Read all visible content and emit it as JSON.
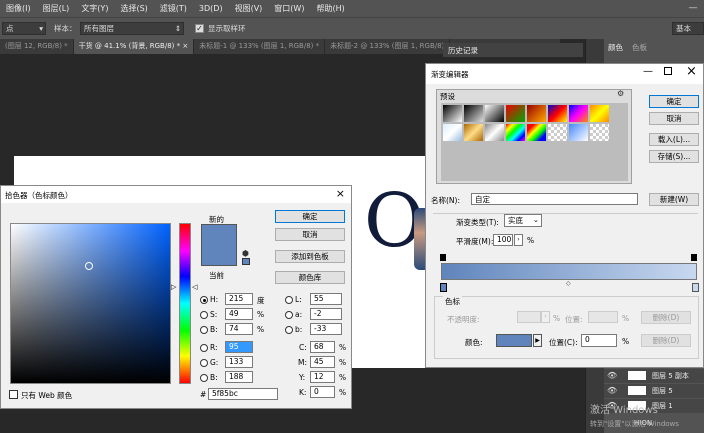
{
  "menubar": {
    "items": [
      "图像(I)",
      "图层(L)",
      "文字(Y)",
      "选择(S)",
      "滤镜(T)",
      "3D(D)",
      "视图(V)",
      "窗口(W)",
      "帮助(H)"
    ]
  },
  "options": {
    "point_label": "点",
    "sample_label": "样本：",
    "sample_value": "所有图层",
    "show_ring_label": "显示取样环",
    "basic_label": "基本"
  },
  "tabs": [
    "(图层 12, RGB/8) *",
    "干货 @ 41.1% (背景, RGB/8) *",
    "未标题-1 @ 133% (图层 1, RGB/8) *",
    "未标题-2 @ 133% (图层 1, RGB/8)"
  ],
  "right_panel": {
    "history_tab": "历史记录",
    "color_tab": "颜色",
    "swatch_tab": "色板",
    "layers": [
      {
        "name": "图层 5 副本"
      },
      {
        "name": "图层 5"
      },
      {
        "name": "图层 1"
      }
    ],
    "bottom_label": "HION"
  },
  "canvas": {
    "text": "O"
  },
  "color_picker": {
    "title": "拾色器（色标颜色）",
    "new_label": "新的",
    "current_label": "当前",
    "ok": "确定",
    "cancel": "取消",
    "add_swatch": "添加到色板",
    "color_libraries": "颜色库",
    "fields": {
      "H": {
        "label": "H:",
        "value": "215",
        "unit": "度"
      },
      "S": {
        "label": "S:",
        "value": "49",
        "unit": "%"
      },
      "B": {
        "label": "B:",
        "value": "74",
        "unit": "%"
      },
      "R": {
        "label": "R:",
        "value": "95"
      },
      "G": {
        "label": "G:",
        "value": "133"
      },
      "Bl": {
        "label": "B:",
        "value": "188"
      },
      "L": {
        "label": "L:",
        "value": "55"
      },
      "a": {
        "label": "a:",
        "value": "-2"
      },
      "b": {
        "label": "b:",
        "value": "-33"
      },
      "C": {
        "label": "C:",
        "value": "68",
        "unit": "%"
      },
      "M": {
        "label": "M:",
        "value": "45",
        "unit": "%"
      },
      "Y": {
        "label": "Y:",
        "value": "12",
        "unit": "%"
      },
      "K": {
        "label": "K:",
        "value": "0",
        "unit": "%"
      }
    },
    "hex_label": "#",
    "hex_value": "5f85bc",
    "web_only_label": "只有 Web 颜色",
    "new_color": "#5f85bc",
    "current_color": "#5f85bc"
  },
  "gradient_editor": {
    "title": "渐变编辑器",
    "presets_label": "预设",
    "ok": "确定",
    "cancel": "取消",
    "load": "载入(L)...",
    "save": "存储(S)...",
    "name_label": "名称(N):",
    "name_value": "自定",
    "new_button": "新建(W)",
    "type_label": "渐变类型(T):",
    "type_value": "实底",
    "smooth_label": "平滑度(M):",
    "smooth_value": "100",
    "smooth_unit": "%",
    "stops_label": "色标",
    "opacity_label": "不透明度:",
    "location_label": "位置:",
    "delete_label": "删除(D)",
    "color_label": "颜色:",
    "color_location_label": "位置(C):",
    "color_location_value": "0",
    "percent": "%",
    "stop_color": "#5f85bc"
  },
  "watermark": {
    "line1": "激活 Windows",
    "line2": "转到\"设置\"以激活 Windows"
  }
}
